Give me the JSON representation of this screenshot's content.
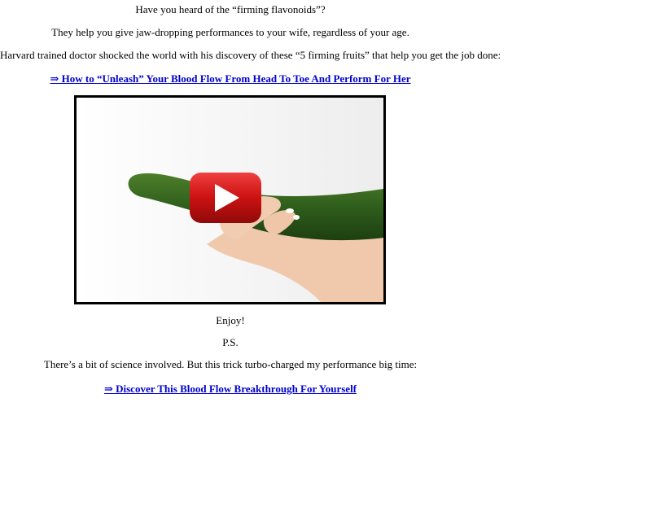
{
  "intro": {
    "line1": "Have you heard of the “firming flavonoids”?",
    "line2": "They help you give jaw-dropping performances to your wife, regardless of your age.",
    "line3": "Harvard trained doctor shocked the world with his discovery of these “5 firming fruits” that help you get the job done:"
  },
  "link1": {
    "label": "⇒ How to “Unleash” Your Blood Flow From Head To Toe And Perform For Her"
  },
  "video": {
    "play_icon": "play-button-icon"
  },
  "outro": {
    "enjoy": "Enjoy!",
    "ps": "P.S.",
    "science": "There’s a bit of science involved. But this trick turbo-charged my performance big time:"
  },
  "link2": {
    "label": "⇒ Discover This Blood Flow Breakthrough For Yourself"
  },
  "colors": {
    "link": "#0000cc",
    "play_red": "#cc1111",
    "cucumber": "#2f5e1c"
  }
}
